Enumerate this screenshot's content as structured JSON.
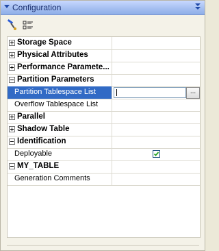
{
  "panel": {
    "title": "Configuration"
  },
  "toolbar": {
    "buttons": [
      {
        "icon": "paintbrush-icon"
      },
      {
        "icon": "property-list-icon"
      }
    ]
  },
  "rows": [
    {
      "label": "Storage Space",
      "kind": "category",
      "expanded": false
    },
    {
      "label": "Physical Attributes",
      "kind": "category",
      "expanded": false
    },
    {
      "label": "Performance Paramete...",
      "kind": "category",
      "expanded": false
    },
    {
      "label": "Partition Parameters",
      "kind": "category",
      "expanded": true
    },
    {
      "label": "Partition Tablespace List",
      "kind": "property",
      "selected": true,
      "value": ""
    },
    {
      "label": "Overflow Tablespace List",
      "kind": "property",
      "value": ""
    },
    {
      "label": "Parallel",
      "kind": "category",
      "expanded": false
    },
    {
      "label": "Shadow Table",
      "kind": "category",
      "expanded": false
    },
    {
      "label": "Identification",
      "kind": "category",
      "expanded": true
    },
    {
      "label": "Deployable",
      "kind": "property",
      "checked": true
    },
    {
      "label": "MY_TABLE",
      "kind": "category",
      "expanded": true
    },
    {
      "label": "Generation Comments",
      "kind": "property",
      "value": ""
    }
  ],
  "ellipsis_label": "...",
  "colors": {
    "selection": "#316ac5",
    "titlebar": "#a9c2f2",
    "check": "#21a121"
  }
}
